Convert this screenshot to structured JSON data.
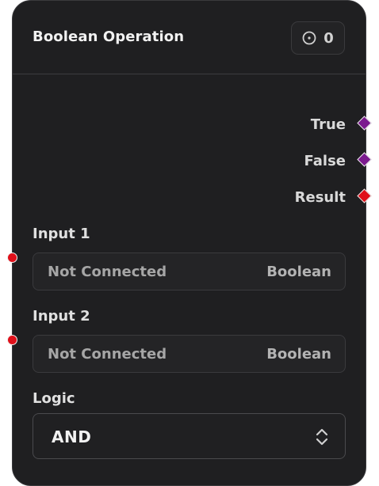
{
  "node": {
    "title": "Boolean Operation",
    "badge_count": "0",
    "badge_icon": "circle-dot-icon"
  },
  "outputs": [
    {
      "label": "True",
      "port_color": "#7b1a8f",
      "port_shape": "diamond"
    },
    {
      "label": "False",
      "port_color": "#7b1a8f",
      "port_shape": "diamond"
    },
    {
      "label": "Result",
      "port_color": "#e0101a",
      "port_shape": "diamond"
    }
  ],
  "inputs": [
    {
      "label": "Input 1",
      "value": "Not Connected",
      "type": "Boolean",
      "port_color": "#e0101a"
    },
    {
      "label": "Input 2",
      "value": "Not Connected",
      "type": "Boolean",
      "port_color": "#e0101a"
    }
  ],
  "logic": {
    "label": "Logic",
    "selected": "AND",
    "icon": "chevron-up-down-icon"
  }
}
